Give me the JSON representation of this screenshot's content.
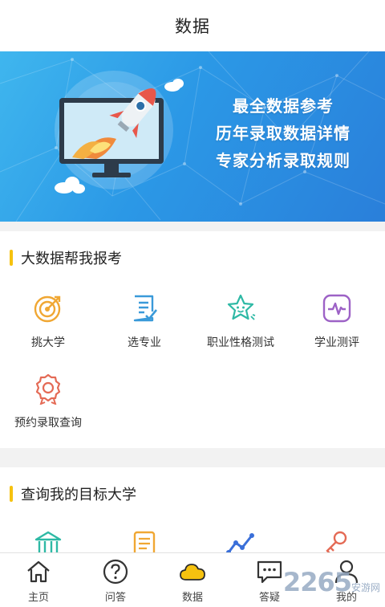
{
  "header": {
    "title": "数据"
  },
  "banner": {
    "lines": [
      "最全数据参考",
      "历年录取数据详情",
      "专家分析录取规则"
    ]
  },
  "section1": {
    "title": "大数据帮我报考",
    "items": [
      {
        "label": "挑大学",
        "icon": "target-icon",
        "color": "#f0a733"
      },
      {
        "label": "选专业",
        "icon": "checklist-icon",
        "color": "#3a9ad9"
      },
      {
        "label": "职业性格测试",
        "icon": "star-face-icon",
        "color": "#2eb9a5"
      },
      {
        "label": "学业测评",
        "icon": "pulse-chart-icon",
        "color": "#9d62c6"
      },
      {
        "label": "预约录取查询",
        "icon": "award-badge-icon",
        "color": "#e46a55"
      }
    ]
  },
  "section2": {
    "title": "查询我的目标大学",
    "items": [
      {
        "icon": "school-building-icon",
        "color": "#2eb9a5"
      },
      {
        "icon": "scroll-icon",
        "color": "#f0a733"
      },
      {
        "icon": "line-chart-icon",
        "color": "#3a6fd9"
      },
      {
        "icon": "key-icon",
        "color": "#e46a55"
      }
    ]
  },
  "tabs": [
    {
      "label": "主页",
      "icon": "home-icon",
      "active": false
    },
    {
      "label": "问答",
      "icon": "question-icon",
      "active": false
    },
    {
      "label": "数据",
      "icon": "cloud-icon",
      "active": true,
      "color": "#f6c20f"
    },
    {
      "label": "答疑",
      "icon": "chat-icon",
      "active": false
    },
    {
      "label": "我的",
      "icon": "user-icon",
      "active": false
    }
  ],
  "watermark": {
    "text": "2265",
    "sub": "安游网"
  }
}
